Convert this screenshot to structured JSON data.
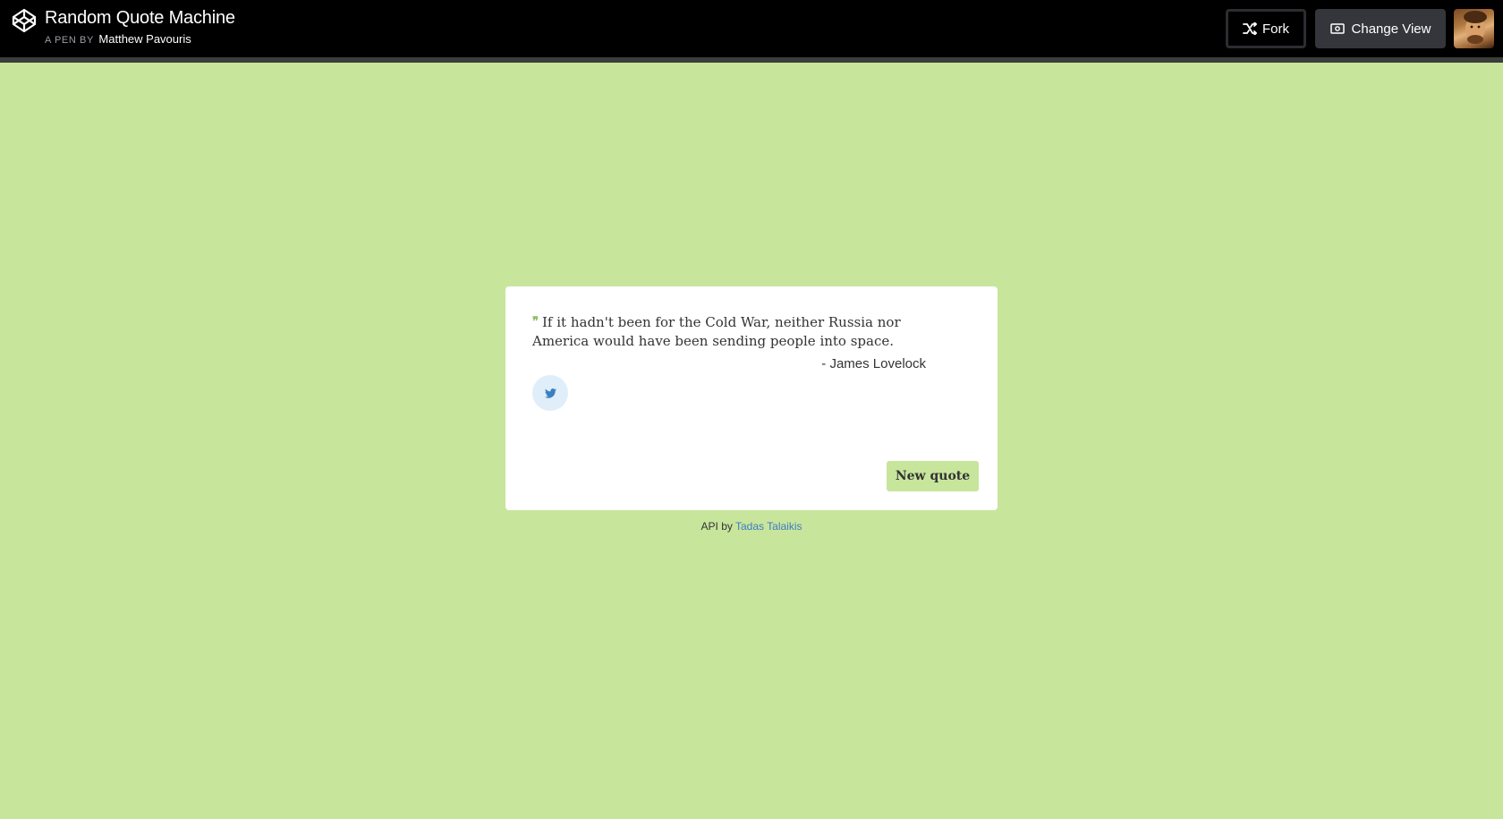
{
  "header": {
    "title": "Random Quote Machine",
    "by_prefix": "A PEN BY",
    "author": "Matthew Pavouris",
    "fork_label": "Fork",
    "change_view_label": "Change View"
  },
  "quote": {
    "text": "If it hadn't been for the Cold War, neither Russia nor America would have been sending people into space.",
    "author": "- James Lovelock",
    "tweet_icon": "twitter-icon",
    "new_quote_label": "New quote"
  },
  "footer": {
    "api_prefix": "API by",
    "api_author": "Tadas Talaikis"
  },
  "colors": {
    "background": "#c8e59c",
    "accent": "#8fbf62",
    "header": "#000000",
    "link": "#3f7cc4"
  }
}
